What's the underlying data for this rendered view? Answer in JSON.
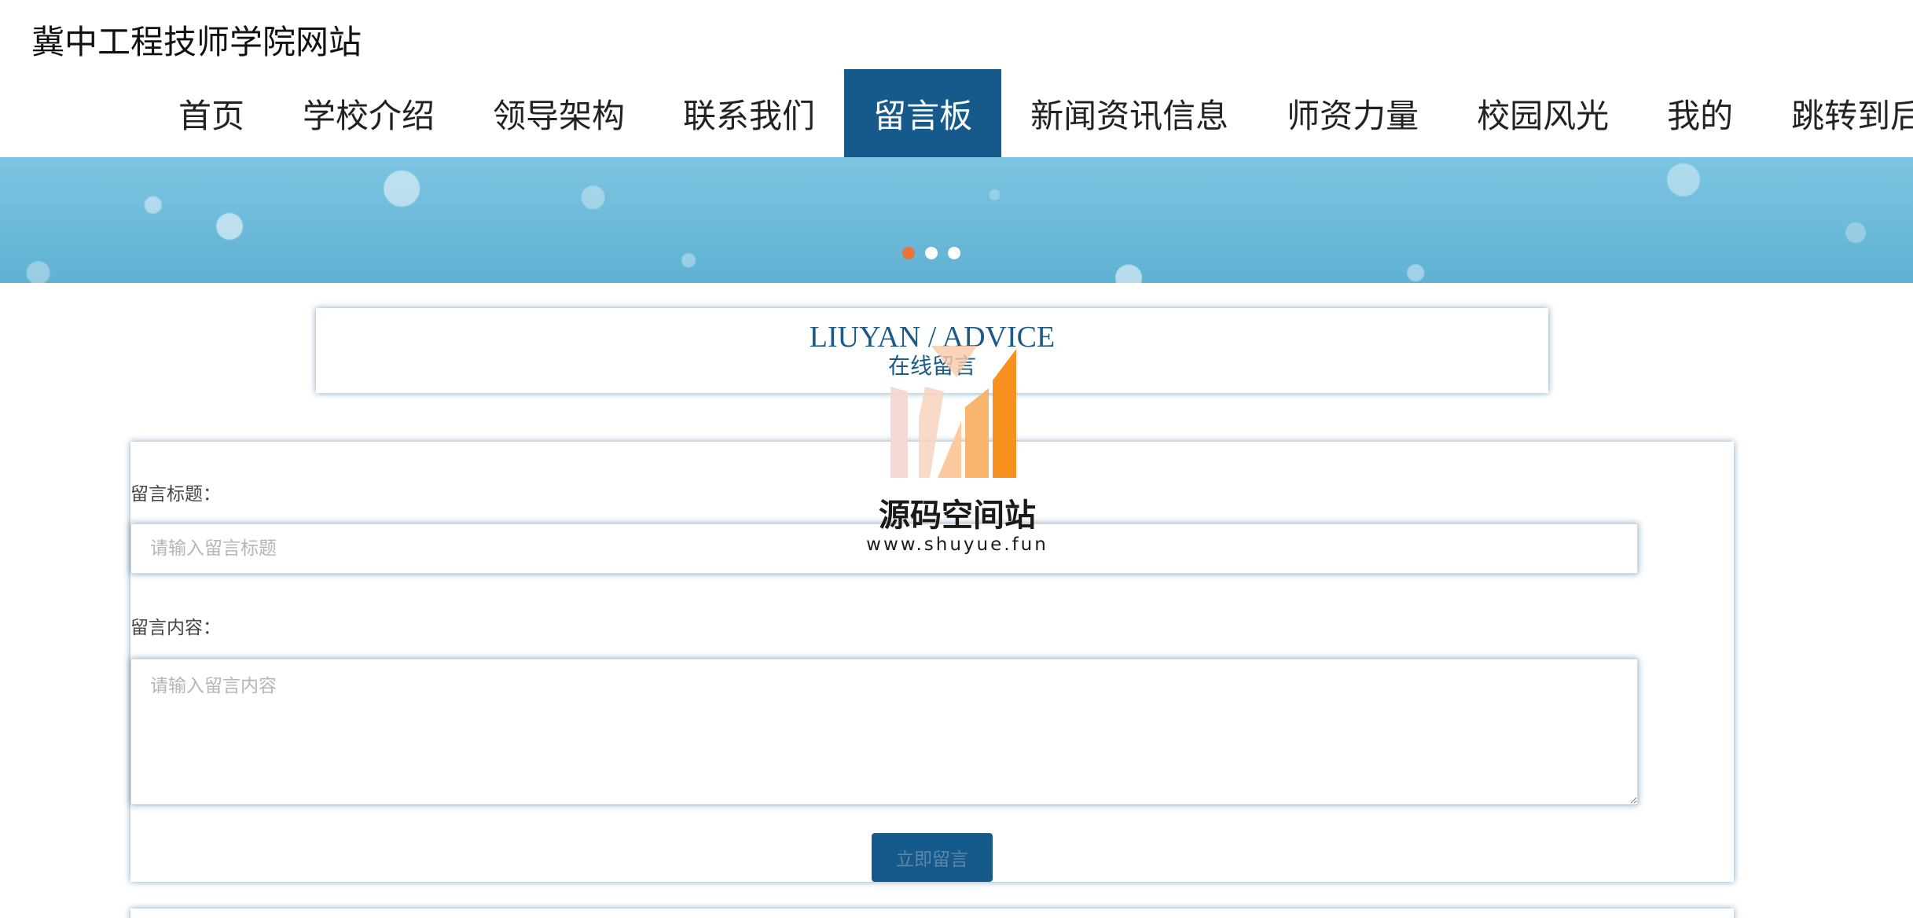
{
  "site": {
    "title": "冀中工程技师学院网站"
  },
  "nav": {
    "items": [
      {
        "label": "首页",
        "active": false
      },
      {
        "label": "学校介绍",
        "active": false
      },
      {
        "label": "领导架构",
        "active": false
      },
      {
        "label": "联系我们",
        "active": false
      },
      {
        "label": "留言板",
        "active": true
      },
      {
        "label": "新闻资讯信息",
        "active": false
      },
      {
        "label": "师资力量",
        "active": false
      },
      {
        "label": "校园风光",
        "active": false
      },
      {
        "label": "我的",
        "active": false
      },
      {
        "label": "跳转到后台",
        "active": false
      }
    ],
    "active_color": "#155a8a"
  },
  "banner": {
    "slide_count": 3,
    "active_slide": 1,
    "active_dot_color": "#e8743a"
  },
  "section": {
    "heading_en": "LIUYAN / ADVICE",
    "heading_cn": "在线留言"
  },
  "form": {
    "title_label": "留言标题：",
    "title_placeholder": "请输入留言标题",
    "title_value": "",
    "content_label": "留言内容：",
    "content_placeholder": "请输入留言内容",
    "content_value": "",
    "submit_label": "立即留言"
  },
  "watermark": {
    "name": "源码空间站",
    "url": "www.shuyue.fun"
  }
}
